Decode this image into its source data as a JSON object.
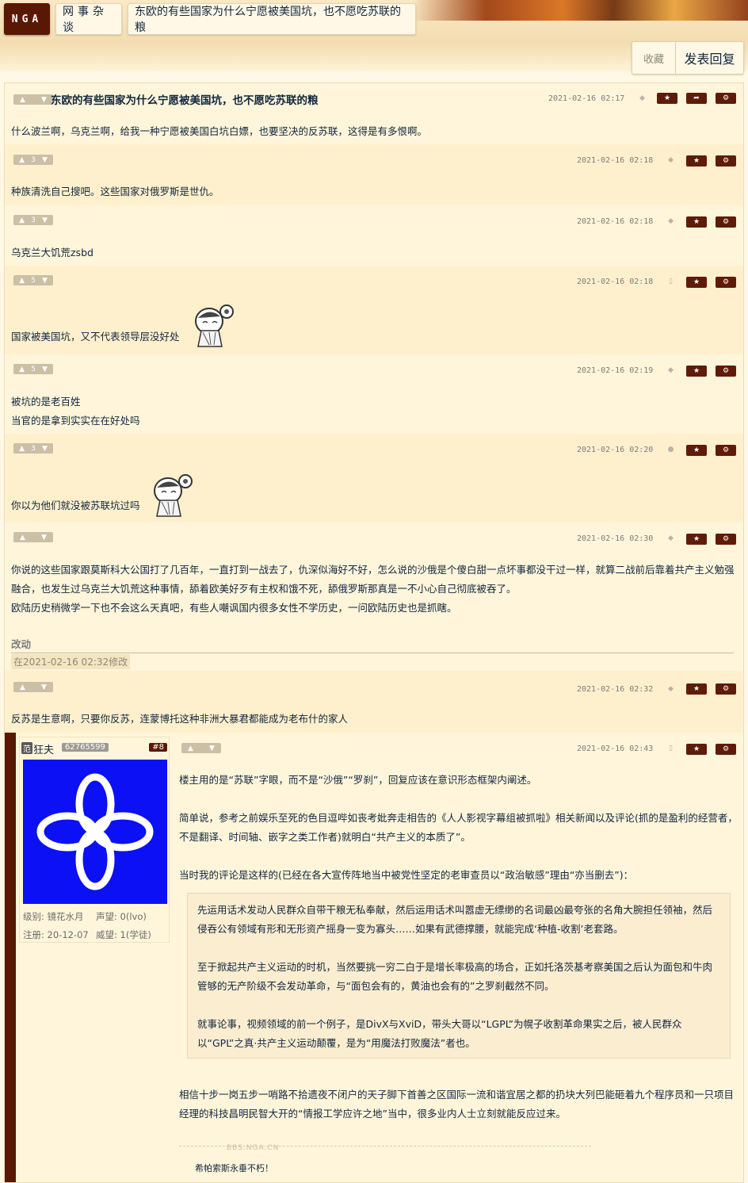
{
  "nav": {
    "logo": "NGA",
    "forum": "网事杂谈",
    "thread_title": "东欧的有些国家为什么宁愿被美国坑，也不愿吃苏联的粮"
  },
  "actions": {
    "favorite": "收藏",
    "reply": "发表回复"
  },
  "posts": [
    {
      "title": "东欧的有些国家为什么宁愿被美国坑，也不愿吃苏联的粮",
      "votes": "",
      "date": "2021-02-16 02:17",
      "lines": [
        "什么波兰啊，乌克兰啊，给我一种宁愿被美国白坑白嫖，也要坚决的反苏联，这得是有多恨啊。"
      ]
    },
    {
      "votes": "3",
      "date": "2021-02-16 02:18",
      "lines": [
        "种族清洗自己搜吧。这些国家对俄罗斯是世仇。"
      ]
    },
    {
      "votes": "3",
      "date": "2021-02-16 02:18",
      "lines": [
        "乌克兰大饥荒zsbd"
      ]
    },
    {
      "votes": "5",
      "date": "2021-02-16 02:18",
      "lines": [
        "国家被美国坑，又不代表领导层没好处"
      ]
    },
    {
      "votes": "5",
      "date": "2021-02-16 02:19",
      "lines": [
        "被坑的是老百姓",
        "当官的是拿到实实在在好处吗"
      ]
    },
    {
      "votes": "3",
      "date": "2021-02-16 02:20",
      "lines": [
        "你以为他们就没被苏联坑过吗"
      ]
    },
    {
      "votes": "",
      "date": "2021-02-16 02:30",
      "lines": [
        "你说的这些国家跟莫斯科大公国打了几百年，一直打到一战去了，仇深似海好不好，怎么说的沙俄是个傻白甜一点坏事都没干过一样，就算二战前后靠着共产主义勉强融合，也发生过乌克兰大饥荒这种事情，舔着欧美好歹有主权和饿不死，舔俄罗斯那真是一不小心自己彻底被吞了。",
        "欧陆历史稍微学一下也不会这么天真吧，有些人嘲讽国内很多女性不学历史，一问欧陆历史也是抓瞎。"
      ],
      "edit_label": "改动",
      "edit_note": "在2021-02-16 02:32修改"
    },
    {
      "votes": "",
      "date": "2021-02-16 02:32",
      "lines": [
        "反苏是生意啊，只要你反苏，连蒙博托这种非洲大暴君都能成为老布什的家人"
      ]
    },
    {
      "votes": "",
      "date": "2021-02-16 02:43",
      "user": {
        "tag": "范",
        "name": "狂夫",
        "uid": "62765599",
        "floor": "#8",
        "level": "级别: 镜花水月",
        "fame": "声望: 0(lvo)",
        "reg": "注册: 20-12-07",
        "prestige": "威望: 1(学徒)"
      },
      "paras": [
        "楼主用的是“苏联”字眼，而不是“沙俄”“罗刹”，回复应该在意识形态框架内阐述。",
        "简单说，参考之前娱乐至死的色目逗哔如丧考妣奔走相告的《人人影视字幕组被抓啦》相关新闻以及评论(抓的是盈利的经营者，不是翻译、时间轴、嵌字之类工作者)就明白“共产主义的本质了”。",
        "当时我的评论是这样的(已经在各大宣传阵地当中被党性坚定的老审查员以“政治敏感”理由“亦当删去”)："
      ],
      "quote": [
        "先运用话术发动人民群众自带干粮无私奉献，然后运用话术叫嚣虚无缥缈的名词最凶最夸张的名角大腕担任领袖，然后侵吞公有领域有形和无形资产摇身一变为寡头……如果有武德撑腰，就能完成‘种植-收割’老套路。",
        "至于掀起共产主义运动的时机，当然要挑一穷二白于是增长率极高的场合，正如托洛茨基考察美国之后认为面包和牛肉管够的无产阶级不会发动革命，与“面包会有的，黄油也会有的”之罗刹截然不同。",
        "就事论事，视频领域的前一个例子，是DivX与XviD，带头大哥以“LGPL”为幌子收割革命果实之后，被人民群众以“GPL”之真·共产主义运动颠覆，是为“用魔法打败魔法”者也。"
      ],
      "after": "相信十步一岗五步一哨路不拾遗夜不闭户的天子脚下首善之区国际一流和谐宜居之都的扔块大列巴能砸着九个程序员和一只项目经理的科技昌明民智大开的“情报工学应许之地”当中，很多业内人士立刻就能反应过来。",
      "signature": "希帕索斯永垂不朽！",
      "watermark": "BBS.NGA.CN"
    }
  ],
  "icons": {
    "star": "star-icon",
    "share": "share-icon",
    "settings": "gear-icon",
    "android": "android-icon",
    "apple": "apple-icon",
    "phone": "phone-icon"
  },
  "colors": {
    "accent": "#591804",
    "bg": "#fff8e5"
  }
}
